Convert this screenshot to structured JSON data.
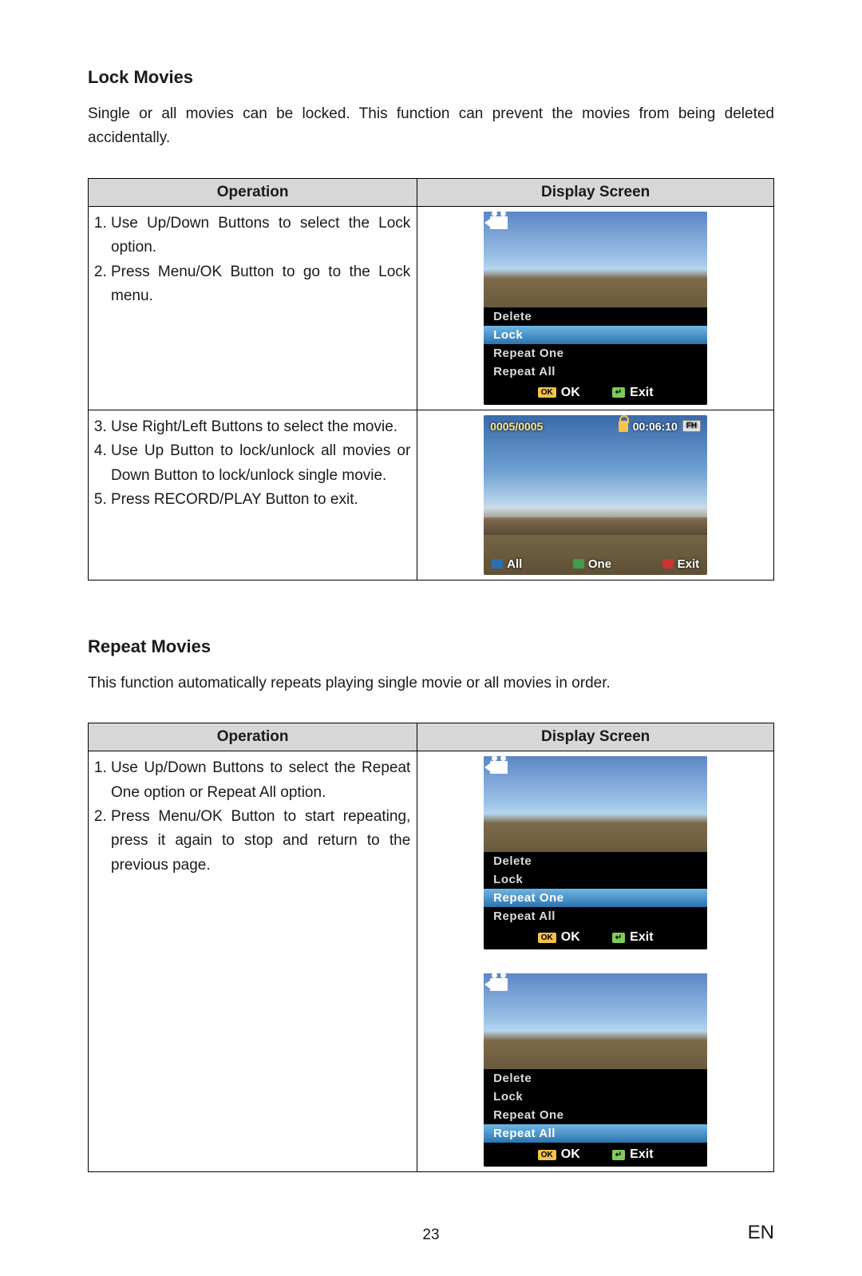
{
  "sections": {
    "lock": {
      "title": "Lock Movies",
      "intro": "Single or all movies can be locked. This function can prevent the movies from being deleted accidentally.",
      "row1_steps": [
        "Use Up/Down Buttons to select the Lock option.",
        "Press Menu/OK Button to go to the Lock menu."
      ],
      "row2_steps": [
        "Use Right/Left Buttons to select the movie.",
        "Use Up Button to lock/unlock all movies or Down Button to lock/unlock single movie.",
        "Press RECORD/PLAY Button to exit."
      ],
      "menu": {
        "items": [
          "Delete",
          "Lock",
          "Repeat One",
          "Repeat All"
        ],
        "selected": "Lock",
        "footer_ok": "OK",
        "footer_ok_chip": "OK",
        "footer_exit": "Exit",
        "footer_exit_chip": "↵"
      },
      "playback": {
        "counter": "0005/0005",
        "time": "00:06:10",
        "badge": "FH",
        "bottom_all": "All",
        "bottom_one": "One",
        "bottom_exit": "Exit"
      }
    },
    "repeat": {
      "title": "Repeat Movies",
      "intro": "This function automatically repeats playing single movie or all movies in order.",
      "row1_steps": [
        "Use Up/Down Buttons to select the Repeat One option or Repeat All option.",
        "Press Menu/OK Button to start repeating, press it again to stop and return to the previous page."
      ],
      "menu_a": {
        "items": [
          "Delete",
          "Lock",
          "Repeat One",
          "Repeat All"
        ],
        "selected": "Repeat One",
        "footer_ok": "OK",
        "footer_ok_chip": "OK",
        "footer_exit": "Exit",
        "footer_exit_chip": "↵"
      },
      "menu_b": {
        "items": [
          "Delete",
          "Lock",
          "Repeat One",
          "Repeat All"
        ],
        "selected": "Repeat All",
        "footer_ok": "OK",
        "footer_ok_chip": "OK",
        "footer_exit": "Exit",
        "footer_exit_chip": "↵"
      }
    }
  },
  "table_headers": {
    "operation": "Operation",
    "display": "Display Screen"
  },
  "page_footer": {
    "number": "23",
    "lang": "EN"
  }
}
